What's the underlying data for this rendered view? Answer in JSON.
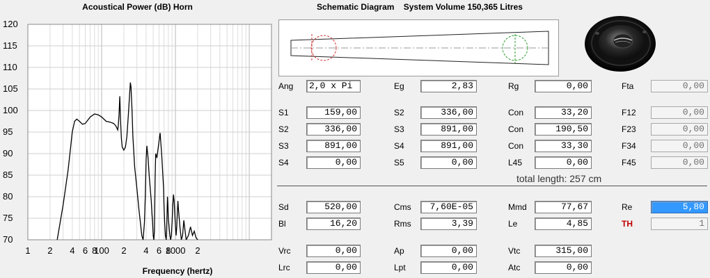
{
  "chart_data": {
    "type": "line",
    "title": "Acoustical Power (dB)   Horn",
    "xlabel": "Frequency (hertz)",
    "ylabel": "",
    "ylim": [
      70,
      120
    ],
    "xlim": [
      10,
      20000
    ],
    "x_scale": "log",
    "grid": true,
    "y_ticks": [
      "120",
      "115",
      "110",
      "105",
      "100",
      "95",
      "90",
      "85",
      "80",
      "75",
      "70"
    ],
    "x_tick_labels": [
      {
        "f": 10,
        "label": "1"
      },
      {
        "f": 20,
        "label": "2"
      },
      {
        "f": 40,
        "label": "4"
      },
      {
        "f": 60,
        "label": "6"
      },
      {
        "f": 80,
        "label": "8"
      },
      {
        "f": 100,
        "label": "100"
      },
      {
        "f": 200,
        "label": "2"
      },
      {
        "f": 400,
        "label": "4"
      },
      {
        "f": 600,
        "label": "6"
      },
      {
        "f": 800,
        "label": "8"
      },
      {
        "f": 1000,
        "label": "1000"
      },
      {
        "f": 2000,
        "label": "2"
      }
    ],
    "series": [
      {
        "color": "#000000",
        "x": [
          25,
          30,
          35,
          38,
          40,
          43,
          46,
          50,
          55,
          60,
          70,
          80,
          90,
          100,
          115,
          130,
          145,
          155,
          160,
          165,
          168,
          172,
          176,
          180,
          185,
          190,
          200,
          210,
          220,
          230,
          240,
          245,
          250,
          258,
          265,
          280,
          300,
          320,
          335,
          350,
          365,
          380,
          390,
          400,
          410,
          425,
          440,
          455,
          470,
          480,
          490,
          500,
          510,
          520,
          530,
          540,
          560,
          590,
          620,
          650,
          670,
          690,
          700,
          715,
          730,
          750,
          760,
          770,
          780,
          790,
          800,
          820,
          840,
          860,
          880,
          900,
          920,
          940,
          960,
          980,
          1000,
          1020,
          1040,
          1060,
          1080,
          1100,
          1150,
          1200,
          1250,
          1300,
          1350,
          1400,
          1500,
          1600,
          1700,
          1800,
          1900,
          2000
        ],
        "y": [
          70,
          78,
          86,
          91.5,
          95,
          97.5,
          98,
          97.5,
          96.8,
          97,
          98.5,
          99.2,
          99,
          98.5,
          97.5,
          97.3,
          97.0,
          96.5,
          96.0,
          95.5,
          96.5,
          99,
          103.3,
          98,
          93.5,
          91.5,
          90.8,
          91.5,
          94,
          99,
          104,
          106.5,
          105.5,
          100,
          94,
          87,
          82,
          77,
          74,
          71,
          70,
          74,
          80,
          88.5,
          91.8,
          89,
          85,
          82,
          79,
          76,
          74,
          71,
          70,
          72,
          84,
          90,
          89,
          92,
          94.8,
          90,
          86,
          82,
          78,
          74,
          71,
          70,
          72,
          76,
          80,
          78,
          75,
          73,
          71,
          70,
          71,
          74,
          78,
          80.5,
          79,
          76,
          73,
          71,
          73,
          76,
          79,
          77,
          73,
          70,
          71,
          74.5,
          72,
          70,
          71,
          73,
          71,
          72,
          70.5,
          70
        ]
      }
    ]
  },
  "schematic": {
    "title": "Schematic Diagram    System Volume 150,365 Litres"
  },
  "form": {
    "rows": [
      [
        {
          "label": "Ang",
          "value": "2,0 x Pi"
        },
        {
          "label": "Eg",
          "value": "2,83"
        },
        {
          "label": "Rg",
          "value": "0,00"
        },
        {
          "label": "Fta",
          "value": "0,00"
        }
      ],
      [
        {
          "label": "S1",
          "value": "159,00"
        },
        {
          "label": "S2",
          "value": "336,00"
        },
        {
          "label": "Con",
          "value": "33,20"
        },
        {
          "label": "F12",
          "value": "0,00"
        }
      ],
      [
        {
          "label": "S2",
          "value": "336,00"
        },
        {
          "label": "S3",
          "value": "891,00"
        },
        {
          "label": "Con",
          "value": "190,50"
        },
        {
          "label": "F23",
          "value": "0,00"
        }
      ],
      [
        {
          "label": "S3",
          "value": "891,00"
        },
        {
          "label": "S4",
          "value": "891,00"
        },
        {
          "label": "Con",
          "value": "33,30"
        },
        {
          "label": "F34",
          "value": "0,00"
        }
      ],
      [
        {
          "label": "S4",
          "value": "0,00"
        },
        {
          "label": "S5",
          "value": "0,00"
        },
        {
          "label": "L45",
          "value": "0,00"
        },
        {
          "label": "F45",
          "value": "0,00"
        }
      ],
      [
        {
          "label": "Sd",
          "value": "520,00"
        },
        {
          "label": "Cms",
          "value": "7,60E-05"
        },
        {
          "label": "Mmd",
          "value": "77,67"
        },
        {
          "label": "Re",
          "value": "5,80"
        }
      ],
      [
        {
          "label": "Bl",
          "value": "16,20"
        },
        {
          "label": "Rms",
          "value": "3,39"
        },
        {
          "label": "Le",
          "value": "4,85"
        },
        {
          "label": "TH",
          "value": "1"
        }
      ],
      [
        {
          "label": "Vrc",
          "value": "0,00"
        },
        {
          "label": "Ap",
          "value": "0,00"
        },
        {
          "label": "Vtc",
          "value": "315,00"
        }
      ],
      [
        {
          "label": "Lrc",
          "value": "0,00"
        },
        {
          "label": "Lpt",
          "value": "0,00"
        },
        {
          "label": "Atc",
          "value": "0,00"
        }
      ]
    ],
    "total_length": "total length: 257 cm"
  }
}
